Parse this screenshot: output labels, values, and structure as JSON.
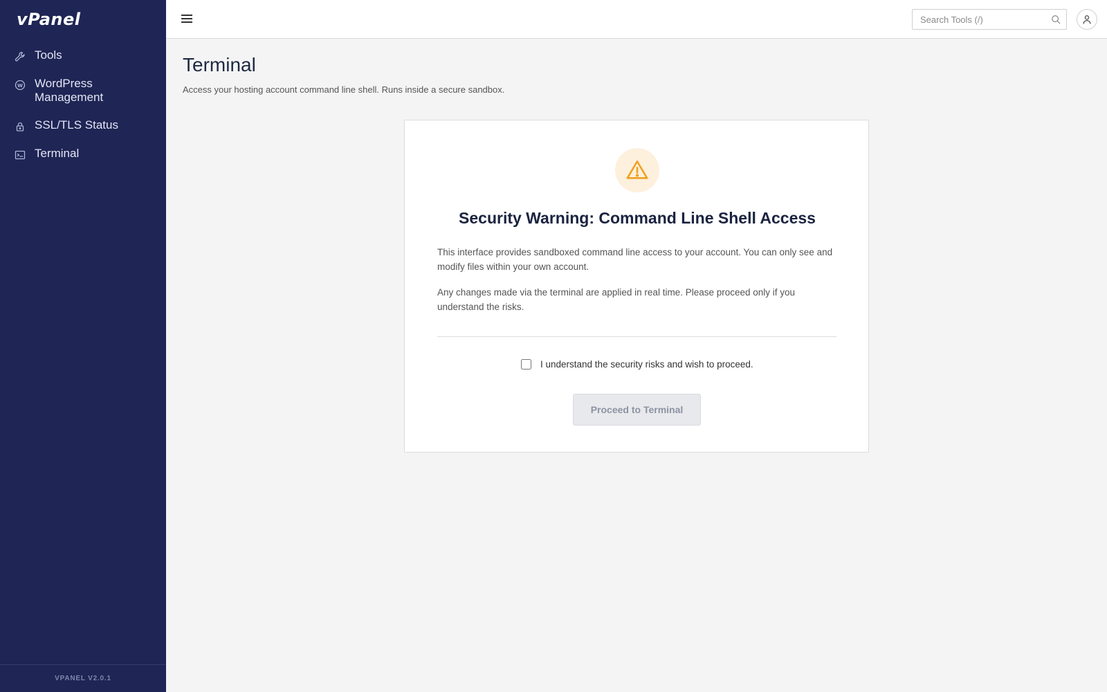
{
  "app": {
    "logo": "vPanel",
    "version": "VPANEL V2.0.1"
  },
  "sidebar": {
    "items": [
      {
        "label": "Tools",
        "icon": "wrench-icon"
      },
      {
        "label": "WordPress Management",
        "icon": "wordpress-icon"
      },
      {
        "label": "SSL/TLS Status",
        "icon": "lock-icon"
      },
      {
        "label": "Terminal",
        "icon": "terminal-icon"
      }
    ]
  },
  "topbar": {
    "search_placeholder": "Search Tools (/)"
  },
  "page": {
    "title": "Terminal",
    "description": "Access your hosting account command line shell. Runs inside a secure sandbox."
  },
  "warning": {
    "title": "Security Warning: Command Line Shell Access",
    "paragraph1": "This interface provides sandboxed command line access to your account. You can only see and modify files within your own account.",
    "paragraph2": "Any changes made via the terminal are applied in real time. Please proceed only if you understand the risks.",
    "ack_label": "I understand the security risks and wish to proceed.",
    "ack_checked": false,
    "button_label": "Proceed to Terminal",
    "button_enabled": false
  },
  "colors": {
    "sidebar_bg": "#1f2554",
    "warning_icon": "#f0a020",
    "warning_bg": "#fdf0dd"
  }
}
